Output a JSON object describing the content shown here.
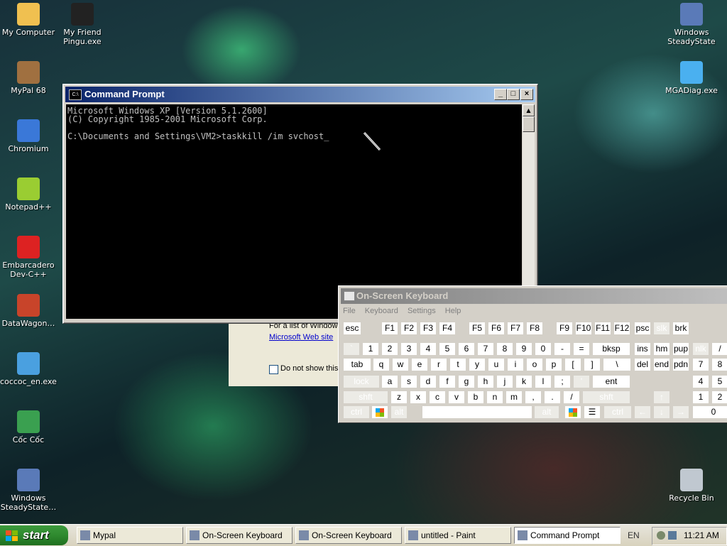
{
  "desktop": {
    "icons_left": [
      {
        "label": "My Computer",
        "icon": "my-computer-icon"
      },
      {
        "label": "My Friend\nPingu.exe",
        "icon": "pingu-icon"
      },
      {
        "label": "MyPal 68",
        "icon": "mypal-icon"
      },
      {
        "label": "Chromium",
        "icon": "chromium-icon"
      },
      {
        "label": "Notepad++",
        "icon": "notepad-plus-plus-icon"
      },
      {
        "label": "Embarcadero\nDev-C++",
        "icon": "dev-cpp-icon"
      },
      {
        "label": "DataWagon…",
        "icon": "datawagon-icon"
      },
      {
        "label": "coccoc_en.exe",
        "icon": "installer-icon"
      },
      {
        "label": "Cốc Cốc",
        "icon": "coccoc-icon"
      },
      {
        "label": "Windows\nSteadyState…",
        "icon": "steadystate-icon"
      }
    ],
    "icons_right": [
      {
        "label": "Windows\nSteadyState",
        "icon": "steadystate-icon"
      },
      {
        "label": "MGADiag.exe",
        "icon": "mgadiag-icon"
      },
      {
        "label": "Recycle Bin",
        "icon": "recycle-bin-icon"
      }
    ]
  },
  "cmd": {
    "title": "Command Prompt",
    "icon_text": "C:\\",
    "lines": [
      "Microsoft Windows XP [Version 5.1.2600]",
      "(C) Copyright 1985-2001 Microsoft Corp.",
      "",
      "C:\\Documents and Settings\\VM2>taskkill /im svchost_"
    ]
  },
  "dialog": {
    "line1": "For a list of Windows",
    "link": "Microsoft Web site",
    "checkbox_label": "Do not show this"
  },
  "osk": {
    "title": "On-Screen Keyboard",
    "menu": [
      "File",
      "Keyboard",
      "Settings",
      "Help"
    ],
    "rows": [
      [
        "esc",
        "F1",
        "F2",
        "F3",
        "F4",
        "F5",
        "F6",
        "F7",
        "F8",
        "F9",
        "F10",
        "F11",
        "F12",
        "psc",
        "slk",
        "brk"
      ],
      [
        "`",
        "1",
        "2",
        "3",
        "4",
        "5",
        "6",
        "7",
        "8",
        "9",
        "0",
        "-",
        "=",
        "bksp",
        "ins",
        "hm",
        "pup",
        "nlk",
        "/"
      ],
      [
        "tab",
        "q",
        "w",
        "e",
        "r",
        "t",
        "y",
        "u",
        "i",
        "o",
        "p",
        "[",
        "]",
        "\\",
        "del",
        "end",
        "pdn",
        "7",
        "8"
      ],
      [
        "lock",
        "a",
        "s",
        "d",
        "f",
        "g",
        "h",
        "j",
        "k",
        "l",
        ";",
        "'",
        "ent",
        "4",
        "5"
      ],
      [
        "shft",
        "z",
        "x",
        "c",
        "v",
        "b",
        "n",
        "m",
        ",",
        ".",
        "/",
        "shft",
        "↑",
        "1",
        "2"
      ],
      [
        "ctrl",
        "win",
        "alt",
        "space",
        "alt",
        "win",
        "menu",
        "ctrl",
        "←",
        "↓",
        "→",
        "0"
      ]
    ]
  },
  "taskbar": {
    "start": "start",
    "items": [
      {
        "label": "Mypal",
        "active": false
      },
      {
        "label": "On-Screen Keyboard",
        "active": false
      },
      {
        "label": "On-Screen Keyboard",
        "active": false
      },
      {
        "label": "untitled - Paint",
        "active": false
      },
      {
        "label": "Command Prompt",
        "active": true
      }
    ],
    "lang": "EN",
    "clock": "11:21 AM"
  }
}
